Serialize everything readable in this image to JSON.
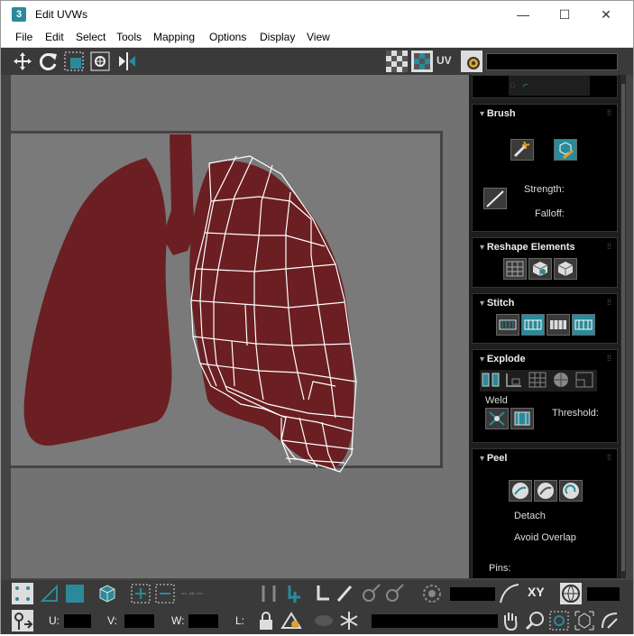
{
  "window": {
    "icon_text": "3",
    "title": "Edit UVWs",
    "min": "—",
    "max": "☐",
    "close": "✕"
  },
  "menu": [
    "File",
    "Edit",
    "Select",
    "Tools",
    "Mapping",
    "Options",
    "Display",
    "View"
  ],
  "toolbar": {
    "uv_label": "UV"
  },
  "panel": {
    "brush": {
      "title": "Brush",
      "strength_label": "Strength:",
      "falloff_label": "Falloff:"
    },
    "reshape": {
      "title": "Reshape Elements"
    },
    "stitch": {
      "title": "Stitch"
    },
    "explode": {
      "title": "Explode",
      "weld_label": "Weld",
      "threshold_label": "Threshold:"
    },
    "peel": {
      "title": "Peel",
      "detach_label": "Detach",
      "avoid_overlap_label": "Avoid Overlap",
      "pins_label": "Pins:"
    }
  },
  "status": {
    "xy_label": "XY",
    "u_label": "U:",
    "v_label": "V:",
    "w_label": "W:",
    "l_label": "L:"
  },
  "colors": {
    "accent": "#2a8a9a",
    "lung": "#6b1f22",
    "panel_bg": "#000000"
  }
}
